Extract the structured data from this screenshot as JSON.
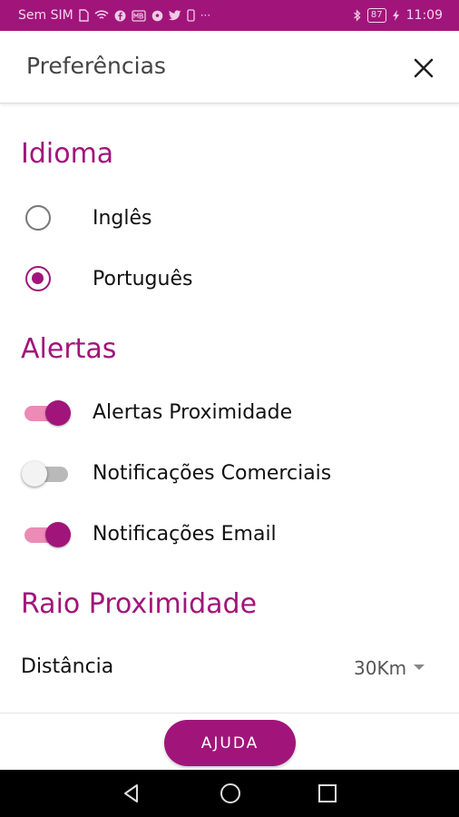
{
  "status_bar": {
    "carrier": "Sem SIM",
    "battery": "87",
    "time": "11:09",
    "icons_left": [
      "sim-icon",
      "wifi-icon",
      "facebook-icon",
      "mb-icon",
      "soccer-icon",
      "twitter-icon",
      "phone-icon",
      "more-icon"
    ],
    "icons_right": [
      "bluetooth-icon",
      "battery-icon",
      "charging-icon"
    ]
  },
  "header": {
    "title": "Preferências",
    "close_icon": "close-icon"
  },
  "language": {
    "title": "Idioma",
    "options": [
      {
        "label": "Inglês",
        "checked": false
      },
      {
        "label": "Português",
        "checked": true
      }
    ]
  },
  "alerts": {
    "title": "Alertas",
    "toggles": [
      {
        "label": "Alertas Proximidade",
        "on": true
      },
      {
        "label": "Notificações Comerciais",
        "on": false
      },
      {
        "label": "Notificações Email",
        "on": true
      }
    ]
  },
  "radius": {
    "title": "Raio Proximidade",
    "distance_label": "Distância",
    "distance_value": "30Km"
  },
  "footer": {
    "help_label": "AJUDA"
  },
  "colors": {
    "accent": "#a1157b",
    "toggle_track_on": "#eb8bb6",
    "toggle_track_off": "#b9b9b9"
  }
}
